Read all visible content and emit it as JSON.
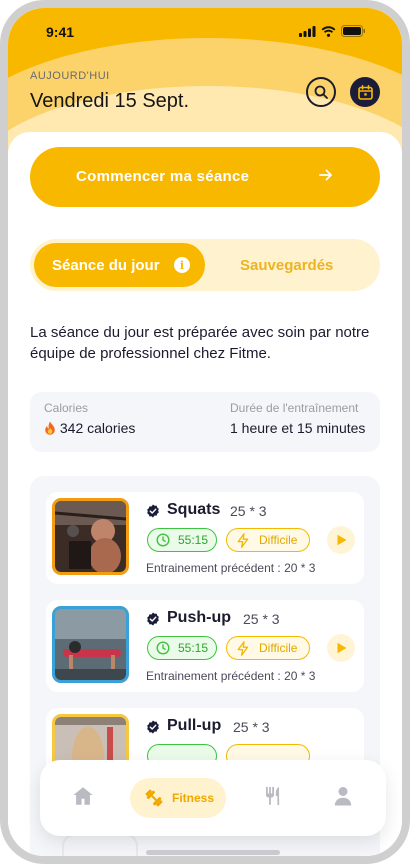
{
  "status": {
    "time": "9:41"
  },
  "header": {
    "today_label": "AUJOURD'HUI",
    "date": "Vendredi 15 Sept."
  },
  "cta": {
    "label": "Commencer ma séance"
  },
  "tabs": {
    "active": "Séance du jour",
    "info_glyph": "i",
    "saved": "Sauvegardés"
  },
  "description": "La séance du jour est préparée avec soin par notre équipe de professionnel chez Fitme.",
  "stats": {
    "calories_label": "Calories",
    "calories_value": "342 calories",
    "duration_label": "Durée de l'entraînement",
    "duration_value": "1 heure et 15 minutes"
  },
  "exercises": [
    {
      "name": "Squats",
      "reps": "25 * 3",
      "time": "55:15",
      "level": "Difficile",
      "previous": "Entrainement précédent : 20 * 3",
      "thumb_color": "#f39c12"
    },
    {
      "name": "Push-up",
      "reps": "25 * 3",
      "time": "55:15",
      "level": "Difficile",
      "previous": "Entrainement précédent : 20 * 3",
      "thumb_color": "#3aa0d8"
    },
    {
      "name": "Pull-up",
      "reps": "25 * 3",
      "time": "",
      "level": "",
      "previous": "",
      "thumb_color": "#f5c842"
    }
  ],
  "nav": {
    "fitness": "Fitness"
  },
  "colors": {
    "accent": "#f9b800",
    "dark": "#1b1b3a",
    "success": "#3ec33e"
  },
  "icons": [
    "search-icon",
    "calendar-icon",
    "arrow-right-icon",
    "info-icon",
    "fire-icon",
    "verified-icon",
    "timer-icon",
    "bolt-icon",
    "play-icon",
    "home-icon",
    "dumbbell-icon",
    "cutlery-icon",
    "user-icon"
  ]
}
